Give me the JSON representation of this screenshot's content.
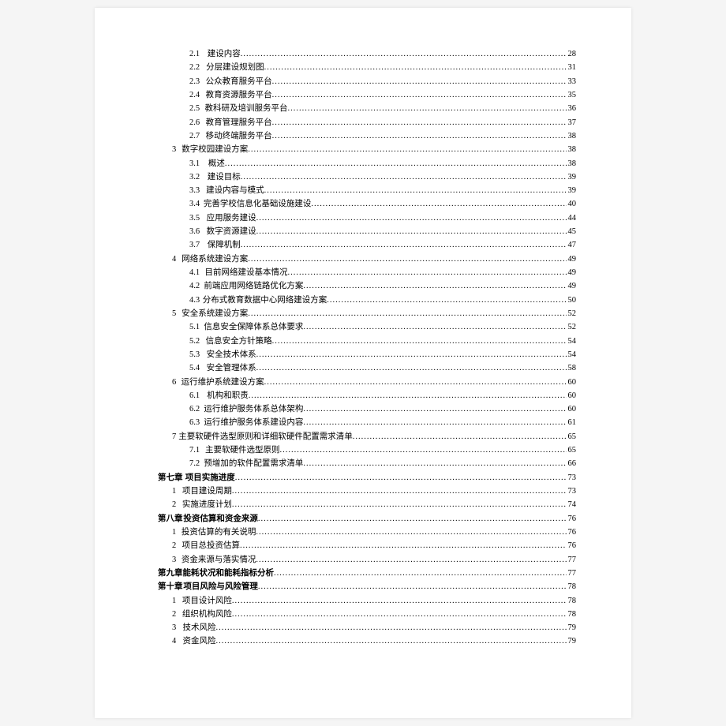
{
  "toc": [
    {
      "level": 2,
      "num": "2.1",
      "title": "建设内容",
      "page": "28",
      "bold": false
    },
    {
      "level": 2,
      "num": "2.2",
      "title": "分层建设规划图",
      "page": "31",
      "bold": false
    },
    {
      "level": 2,
      "num": "2.3",
      "title": "公众教育服务平台",
      "page": "33",
      "bold": false
    },
    {
      "level": 2,
      "num": "2.4",
      "title": "教育资源服务平台",
      "page": "35",
      "bold": false
    },
    {
      "level": 2,
      "num": "2.5",
      "title": "教科研及培训服务平台",
      "page": "36",
      "bold": false
    },
    {
      "level": 2,
      "num": "2.6",
      "title": "教育管理服务平台",
      "page": "37",
      "bold": false
    },
    {
      "level": 2,
      "num": "2.7",
      "title": "移动终端服务平台",
      "page": "38",
      "bold": false
    },
    {
      "level": 1,
      "num": "3",
      "title": "数字校园建设方案",
      "page": "38",
      "bold": false
    },
    {
      "level": 2,
      "num": "3.1",
      "title": "概述",
      "page": "38",
      "bold": false
    },
    {
      "level": 2,
      "num": "3.2",
      "title": "建设目标",
      "page": "39",
      "bold": false
    },
    {
      "level": 2,
      "num": "3.3",
      "title": "建设内容与模式",
      "page": "39",
      "bold": false
    },
    {
      "level": 2,
      "num": "3.4",
      "title": "完善学校信息化基础设施建设",
      "page": "40",
      "bold": false
    },
    {
      "level": 2,
      "num": "3.5",
      "title": "应用服务建设",
      "page": "44",
      "bold": false
    },
    {
      "level": 2,
      "num": "3.6",
      "title": "数字资源建设",
      "page": "45",
      "bold": false
    },
    {
      "level": 2,
      "num": "3.7",
      "title": "保障机制",
      "page": "47",
      "bold": false
    },
    {
      "level": 1,
      "num": "4",
      "title": "网络系统建设方案",
      "page": "49",
      "bold": false
    },
    {
      "level": 2,
      "num": "4.1",
      "title": "目前网络建设基本情况",
      "page": "49",
      "bold": false
    },
    {
      "level": 2,
      "num": "4.2",
      "title": "前端应用网络链路优化方案",
      "page": "49",
      "bold": false
    },
    {
      "level": 2,
      "num": "4.3",
      "title": "分布式教育数据中心网络建设方案",
      "page": "50",
      "bold": false
    },
    {
      "level": 1,
      "num": "5",
      "title": "安全系统建设方案",
      "page": "52",
      "bold": false
    },
    {
      "level": 2,
      "num": "5.1",
      "title": "信息安全保障体系总体要求",
      "page": "52",
      "bold": false
    },
    {
      "level": 2,
      "num": "5.2",
      "title": "信息安全方针策略",
      "page": "54",
      "bold": false
    },
    {
      "level": 2,
      "num": "5.3",
      "title": "安全技术体系",
      "page": "54",
      "bold": false
    },
    {
      "level": 2,
      "num": "5.4",
      "title": "安全管理体系",
      "page": "58",
      "bold": false
    },
    {
      "level": 1,
      "num": "6",
      "title": "运行维护系统建设方案",
      "page": "60",
      "bold": false
    },
    {
      "level": 2,
      "num": "6.1",
      "title": "机构和职责",
      "page": "60",
      "bold": false
    },
    {
      "level": 2,
      "num": "6.2",
      "title": "运行维护服务体系总体架构",
      "page": "60",
      "bold": false
    },
    {
      "level": 2,
      "num": "6.3",
      "title": "运行维护服务体系建设内容",
      "page": "61",
      "bold": false
    },
    {
      "level": 1,
      "num": "7",
      "title": "主要软硬件选型原则和详细软硬件配置需求清单",
      "page": "65",
      "bold": false
    },
    {
      "level": 2,
      "num": "7.1",
      "title": "主要软硬件选型原则",
      "page": "65",
      "bold": false
    },
    {
      "level": 2,
      "num": "7.2",
      "title": "预增加的软件配置需求清单",
      "page": "66",
      "bold": false
    },
    {
      "level": 0,
      "num": "第七章",
      "title": "项目实施进度",
      "page": "73",
      "bold": true
    },
    {
      "level": 1,
      "num": "1",
      "title": "项目建设周期",
      "page": "73",
      "bold": false
    },
    {
      "level": 1,
      "num": "2",
      "title": "实施进度计划",
      "page": "74",
      "bold": false
    },
    {
      "level": 0,
      "num": "第八章",
      "title": "投资估算和资金来源",
      "page": "76",
      "bold": true
    },
    {
      "level": 1,
      "num": "1",
      "title": "投资估算的有关说明",
      "page": "76",
      "bold": false
    },
    {
      "level": 1,
      "num": "2",
      "title": "项目总投资估算",
      "page": "76",
      "bold": false
    },
    {
      "level": 1,
      "num": "3",
      "title": "资金来源与落实情况",
      "page": "77",
      "bold": false
    },
    {
      "level": 0,
      "num": "第九章",
      "title": "能耗状况和能耗指标分析",
      "page": "77",
      "bold": true
    },
    {
      "level": 0,
      "num": "第十章",
      "title": "项目风险与风险管理",
      "page": "78",
      "bold": true
    },
    {
      "level": 1,
      "num": "1",
      "title": "项目设计风险",
      "page": "78",
      "bold": false
    },
    {
      "level": 1,
      "num": "2",
      "title": "组织机构风险",
      "page": "78",
      "bold": false
    },
    {
      "level": 1,
      "num": "3",
      "title": "技术风险",
      "page": "79",
      "bold": false
    },
    {
      "level": 1,
      "num": "4",
      "title": "资金风险",
      "page": "79",
      "bold": false
    }
  ]
}
